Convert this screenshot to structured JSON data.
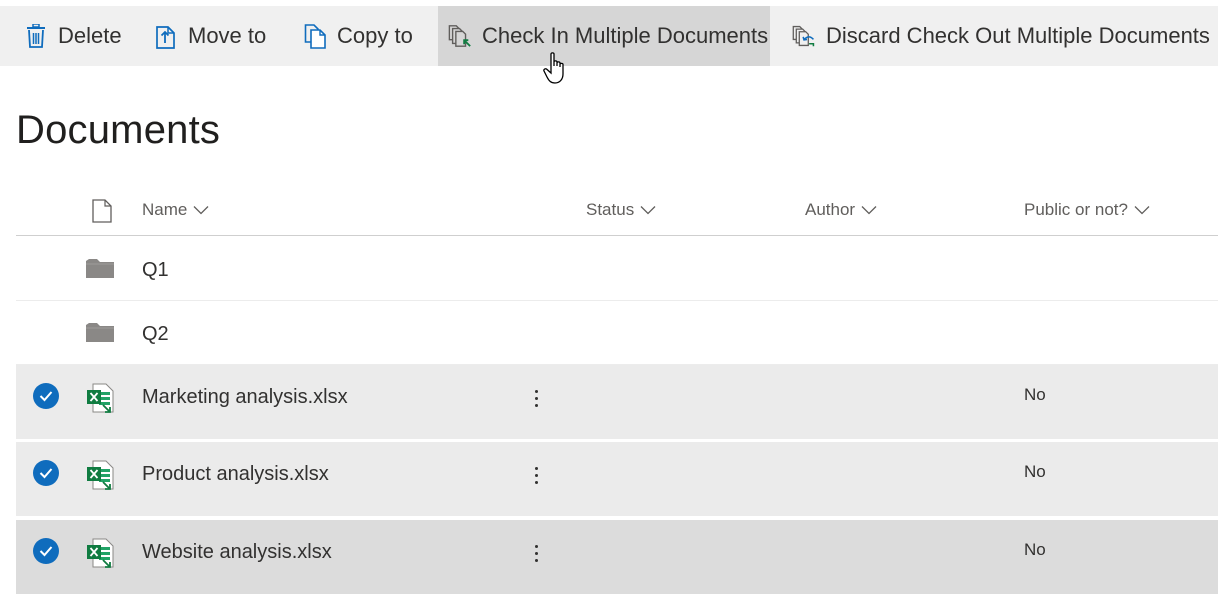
{
  "commandbar": {
    "delete_label": "Delete",
    "move_label": "Move to",
    "copy_label": "Copy to",
    "checkin_label": "Check In Multiple Documents",
    "discard_label": "Discard Check Out Multiple Documents"
  },
  "page": {
    "title": "Documents"
  },
  "columns": {
    "name": "Name",
    "status": "Status",
    "author": "Author",
    "public": "Public or not?"
  },
  "rows": [
    {
      "type": "folder",
      "name": "Q1",
      "public": ""
    },
    {
      "type": "folder",
      "name": "Q2",
      "public": ""
    },
    {
      "type": "xlsx",
      "name": "Marketing analysis.xlsx",
      "public": "No",
      "selected": true
    },
    {
      "type": "xlsx",
      "name": "Product analysis.xlsx",
      "public": "No",
      "selected": true
    },
    {
      "type": "xlsx",
      "name": "Website analysis.xlsx",
      "public": "No",
      "selected": true
    }
  ],
  "colors": {
    "accent": "#0f6cbd",
    "excel": "#107c41",
    "commandbar": "#f0f0f0",
    "hover": "#d6d6d6"
  }
}
